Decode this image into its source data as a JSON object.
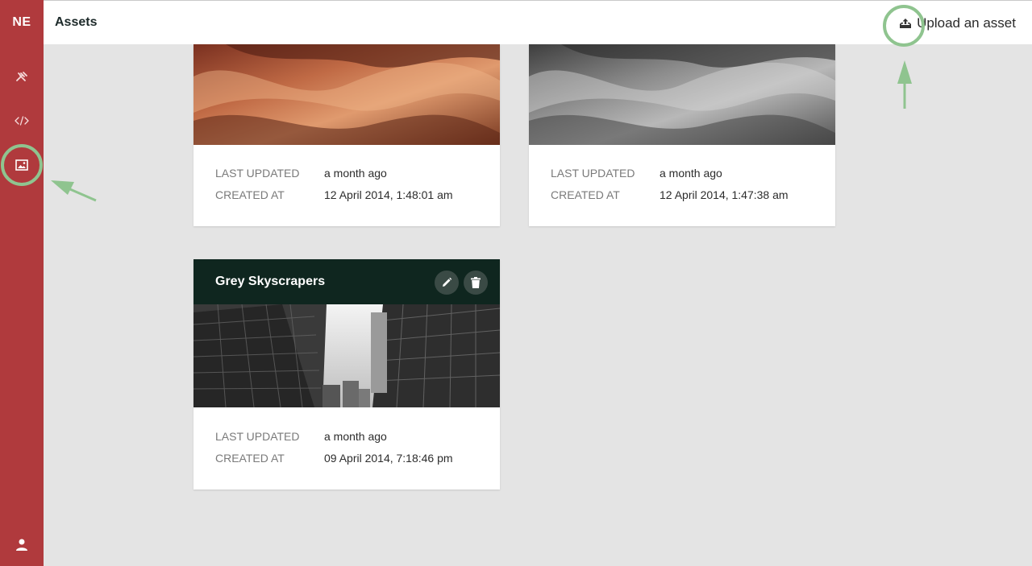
{
  "sidebar": {
    "logo": "NE",
    "items": [
      {
        "icon": "tools-icon"
      },
      {
        "icon": "code-icon"
      },
      {
        "icon": "image-icon"
      },
      {
        "icon": "user-icon"
      }
    ]
  },
  "header": {
    "title": "Assets",
    "upload_label": "Upload an asset",
    "upload_icon": "upload-icon"
  },
  "labels": {
    "last_updated": "LAST UPDATED",
    "created_at": "CREATED AT"
  },
  "cards": [
    {
      "title": "",
      "last_updated": "a month ago",
      "created_at": "12 April 2014, 1:48:01 am"
    },
    {
      "title": "",
      "last_updated": "a month ago",
      "created_at": "12 April 2014, 1:47:38 am"
    },
    {
      "title": "Grey Skyscrapers",
      "last_updated": "a month ago",
      "created_at": "09 April 2014, 7:18:46 pm"
    }
  ],
  "colors": {
    "sidebar": "#b03a3d",
    "card_header": "#0f261f",
    "annotation": "#8fc48f",
    "background": "#e4e4e4"
  }
}
